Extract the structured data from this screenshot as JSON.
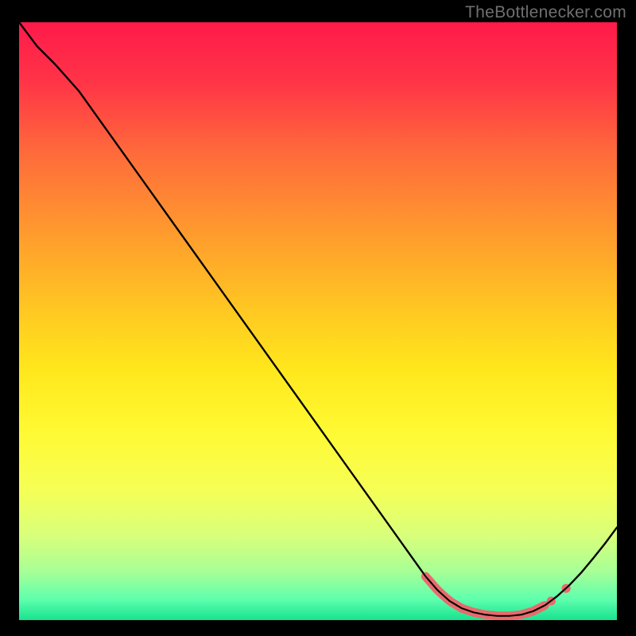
{
  "watermark": "TheBottlenecker.com",
  "chart_data": {
    "type": "line",
    "title": "",
    "xlabel": "",
    "ylabel": "",
    "xlim": [
      0,
      100
    ],
    "ylim": [
      0,
      100
    ],
    "x_curve": [
      0,
      3,
      6,
      10,
      15,
      20,
      25,
      30,
      35,
      40,
      45,
      50,
      55,
      60,
      65,
      68,
      70,
      72,
      74,
      76,
      78,
      80,
      82,
      84,
      86,
      88,
      90,
      92,
      94,
      96,
      98,
      100
    ],
    "y_curve": [
      100,
      96,
      93,
      88.5,
      81.5,
      74.5,
      67.5,
      60.5,
      53.5,
      46.5,
      39.5,
      32.5,
      25.5,
      18.5,
      11.5,
      7.3,
      5.0,
      3.2,
      2.0,
      1.3,
      0.9,
      0.7,
      0.7,
      0.9,
      1.5,
      2.5,
      4.0,
      5.8,
      7.9,
      10.3,
      12.8,
      15.5
    ],
    "highlight_band_x": [
      68,
      92
    ],
    "marker_x": [
      68,
      70,
      72,
      74,
      76,
      78,
      80,
      82,
      84,
      86,
      88,
      89,
      91.5
    ],
    "marker_y": [
      7.3,
      5.0,
      3.2,
      2.0,
      1.3,
      0.9,
      0.7,
      0.7,
      0.9,
      1.5,
      2.5,
      3.2,
      5.3
    ],
    "gradient_stops": [
      {
        "offset": 0.0,
        "color": "#ff1a4a"
      },
      {
        "offset": 0.1,
        "color": "#ff3447"
      },
      {
        "offset": 0.22,
        "color": "#ff6b3b"
      },
      {
        "offset": 0.35,
        "color": "#ff9a2e"
      },
      {
        "offset": 0.48,
        "color": "#ffc722"
      },
      {
        "offset": 0.58,
        "color": "#ffe71c"
      },
      {
        "offset": 0.68,
        "color": "#fff932"
      },
      {
        "offset": 0.78,
        "color": "#f6ff55"
      },
      {
        "offset": 0.86,
        "color": "#d8ff7b"
      },
      {
        "offset": 0.92,
        "color": "#a6ff97"
      },
      {
        "offset": 0.965,
        "color": "#5fffad"
      },
      {
        "offset": 1.0,
        "color": "#18e28f"
      }
    ],
    "curve_color": "#000000",
    "marker_color": "#e96a6c"
  }
}
